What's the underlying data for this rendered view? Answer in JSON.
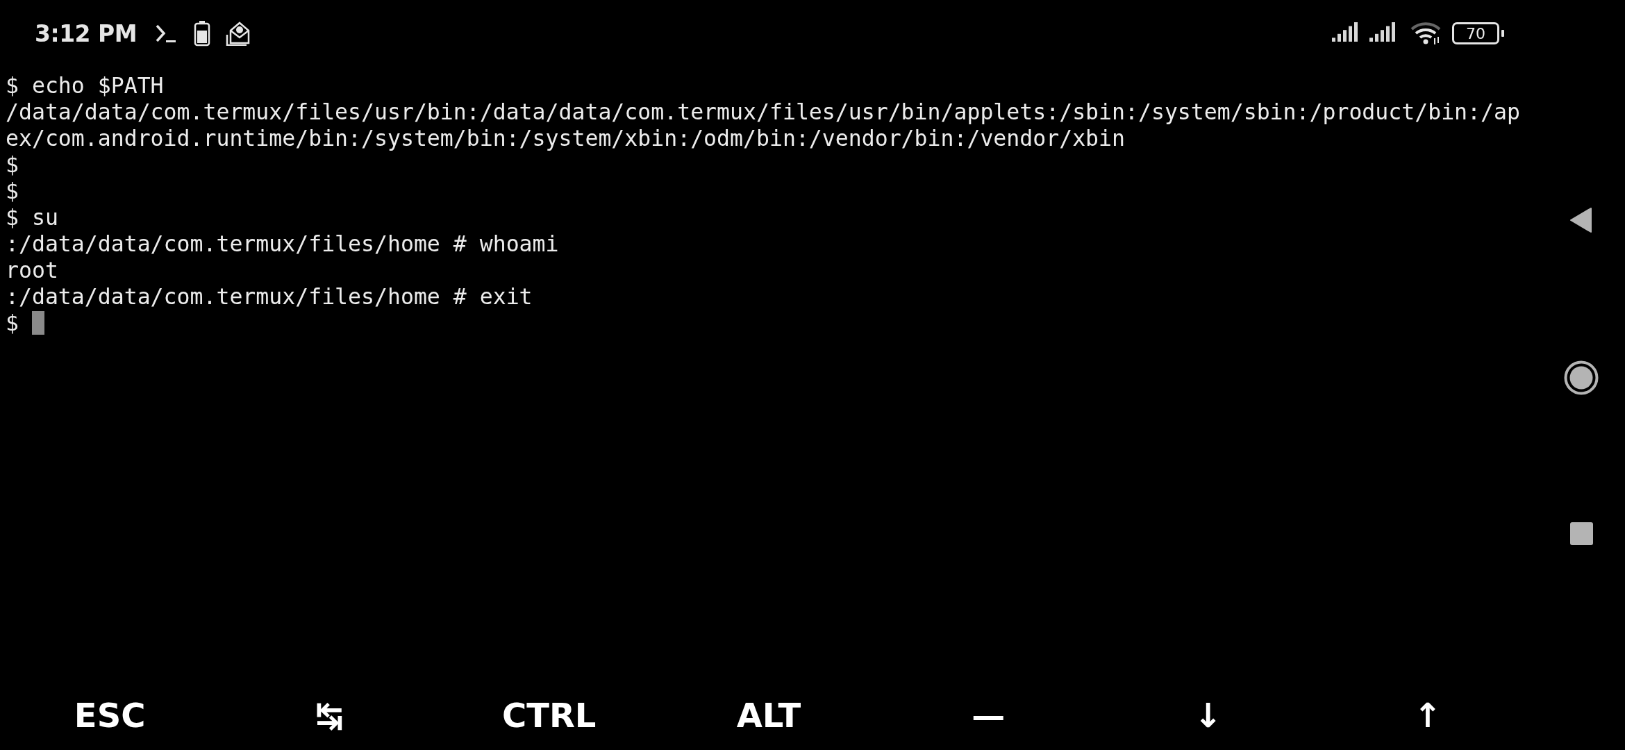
{
  "status_bar": {
    "time": "3:12 PM",
    "battery_percent": "70"
  },
  "terminal": {
    "lines": [
      "$ echo $PATH",
      "/data/data/com.termux/files/usr/bin:/data/data/com.termux/files/usr/bin/applets:/sbin:/system/sbin:/product/bin:/ap",
      "ex/com.android.runtime/bin:/system/bin:/system/xbin:/odm/bin:/vendor/bin:/vendor/xbin",
      "$",
      "$",
      "$ su",
      ":/data/data/com.termux/files/home # whoami",
      "root",
      ":/data/data/com.termux/files/home # exit",
      "$ "
    ],
    "cursor_visible": true
  },
  "extra_keys": [
    "ESC",
    "↹",
    "CTRL",
    "ALT",
    "—",
    "↓",
    "↑"
  ]
}
